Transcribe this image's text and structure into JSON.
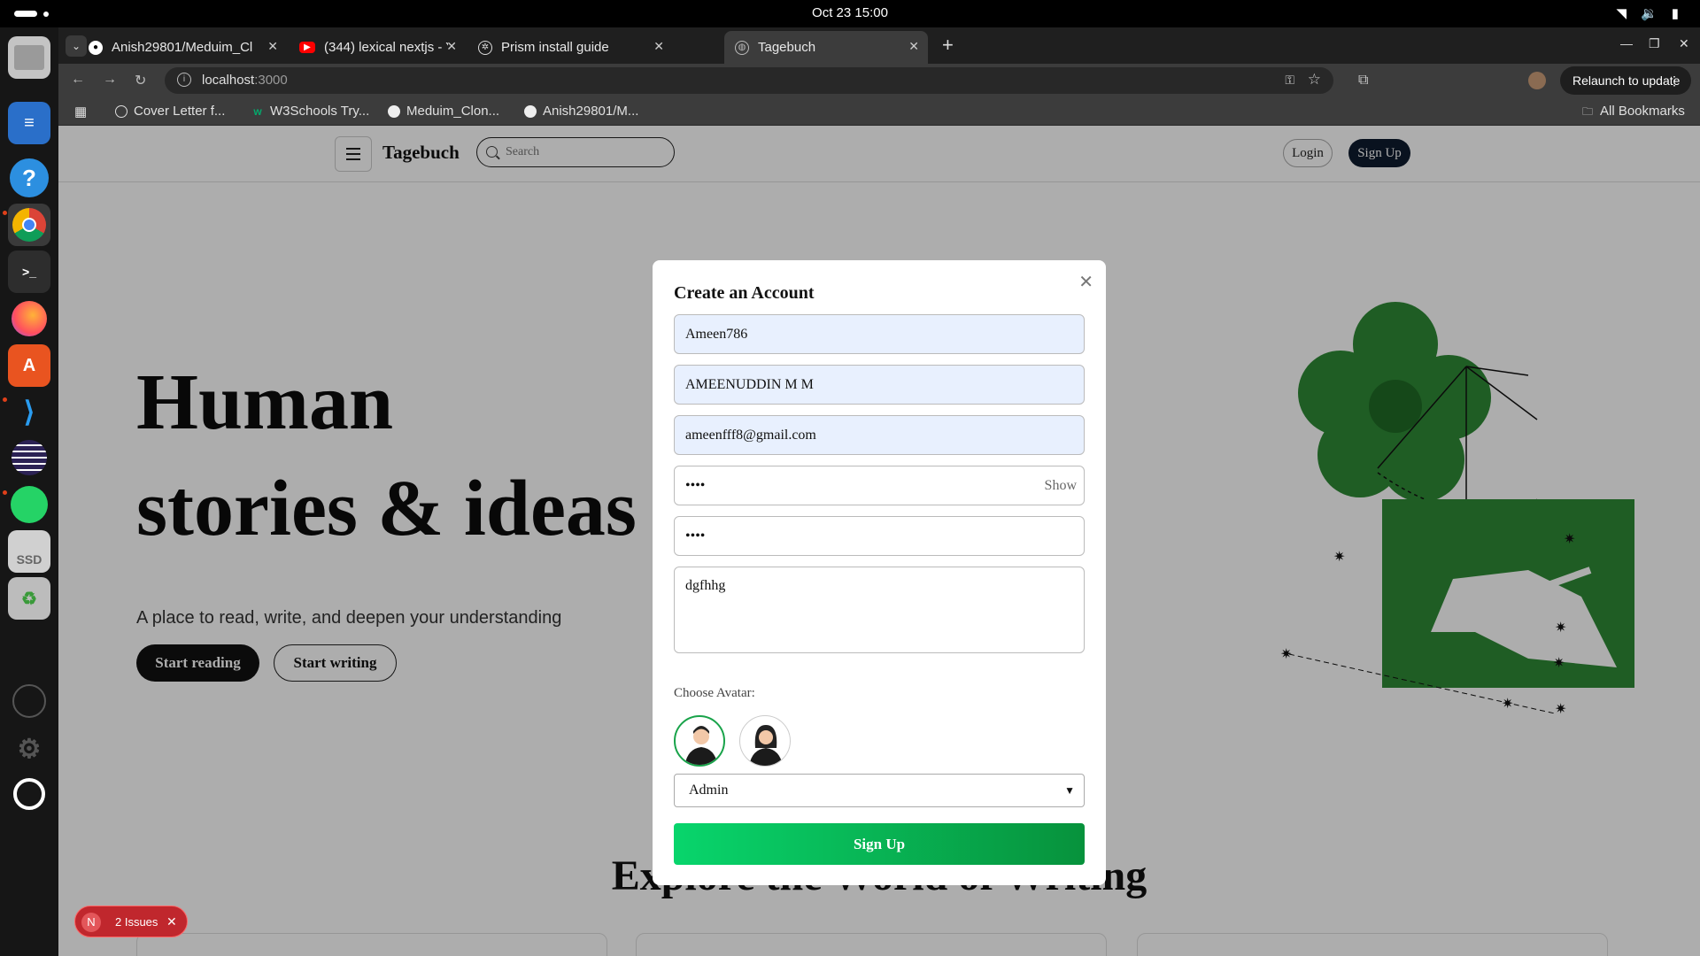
{
  "system": {
    "clock": "Oct 23  15:00",
    "tray_icons": [
      "wifi-icon",
      "volume-icon",
      "battery-icon"
    ]
  },
  "dock": {
    "apps": [
      "files",
      "text-editor",
      "help",
      "chrome",
      "terminal",
      "firefox",
      "app-center",
      "vscode",
      "eclipse",
      "whatsapp",
      "ssd-drive",
      "trash",
      "account",
      "settings",
      "ubuntu-menu"
    ],
    "drive_label": "SSD"
  },
  "browser": {
    "tabs": [
      {
        "title": "Anish29801/Meduim_Cl",
        "icon": "github-icon"
      },
      {
        "title": "(344) lexical nextjs - YouT",
        "icon": "youtube-icon"
      },
      {
        "title": "Prism install guide",
        "icon": "openai-icon"
      },
      {
        "title": "Tagebuch",
        "icon": "globe-icon"
      }
    ],
    "active_tab": 3,
    "url_host": "localhost",
    "url_port": ":3000",
    "relaunch_label": "Relaunch to update",
    "bookmarks": [
      {
        "label": "Cover Letter f...",
        "icon": "chrome-icon"
      },
      {
        "label": "W3Schools Try...",
        "icon": "w3schools-icon"
      },
      {
        "label": "Meduim_Clon...",
        "icon": "github-icon"
      },
      {
        "label": "Anish29801/M...",
        "icon": "github-icon"
      }
    ],
    "all_bookmarks_label": "All Bookmarks"
  },
  "site": {
    "brand": "Tagebuch",
    "search_placeholder": "Search",
    "login_label": "Login",
    "signup_label": "Sign Up",
    "hero": {
      "line1": "Human",
      "line2": "stories & ideas",
      "subtitle": "A place to read, write, and deepen your understanding",
      "start_reading": "Start reading",
      "start_writing": "Start writing"
    },
    "explore_heading": "Explore the World of Writing"
  },
  "modal": {
    "title": "Create an Account",
    "username": "Ameen786",
    "full_name": "AMEENUDDIN M M",
    "email": "ameenfff8@gmail.com",
    "password_mask": "••••",
    "password_toggle": "Show",
    "confirm_mask": "••••",
    "bio": "dgfhhg",
    "avatar_label": "Choose Avatar:",
    "avatars": [
      "male-avatar",
      "female-avatar"
    ],
    "selected_avatar": 0,
    "role": "Admin",
    "submit_label": "Sign Up"
  },
  "devtools": {
    "badge_letter": "N",
    "issues_label": "2 Issues"
  },
  "colors": {
    "accent_green": "#07923c",
    "illustration_green": "#2f8a36",
    "issues_red": "#c0272d"
  }
}
